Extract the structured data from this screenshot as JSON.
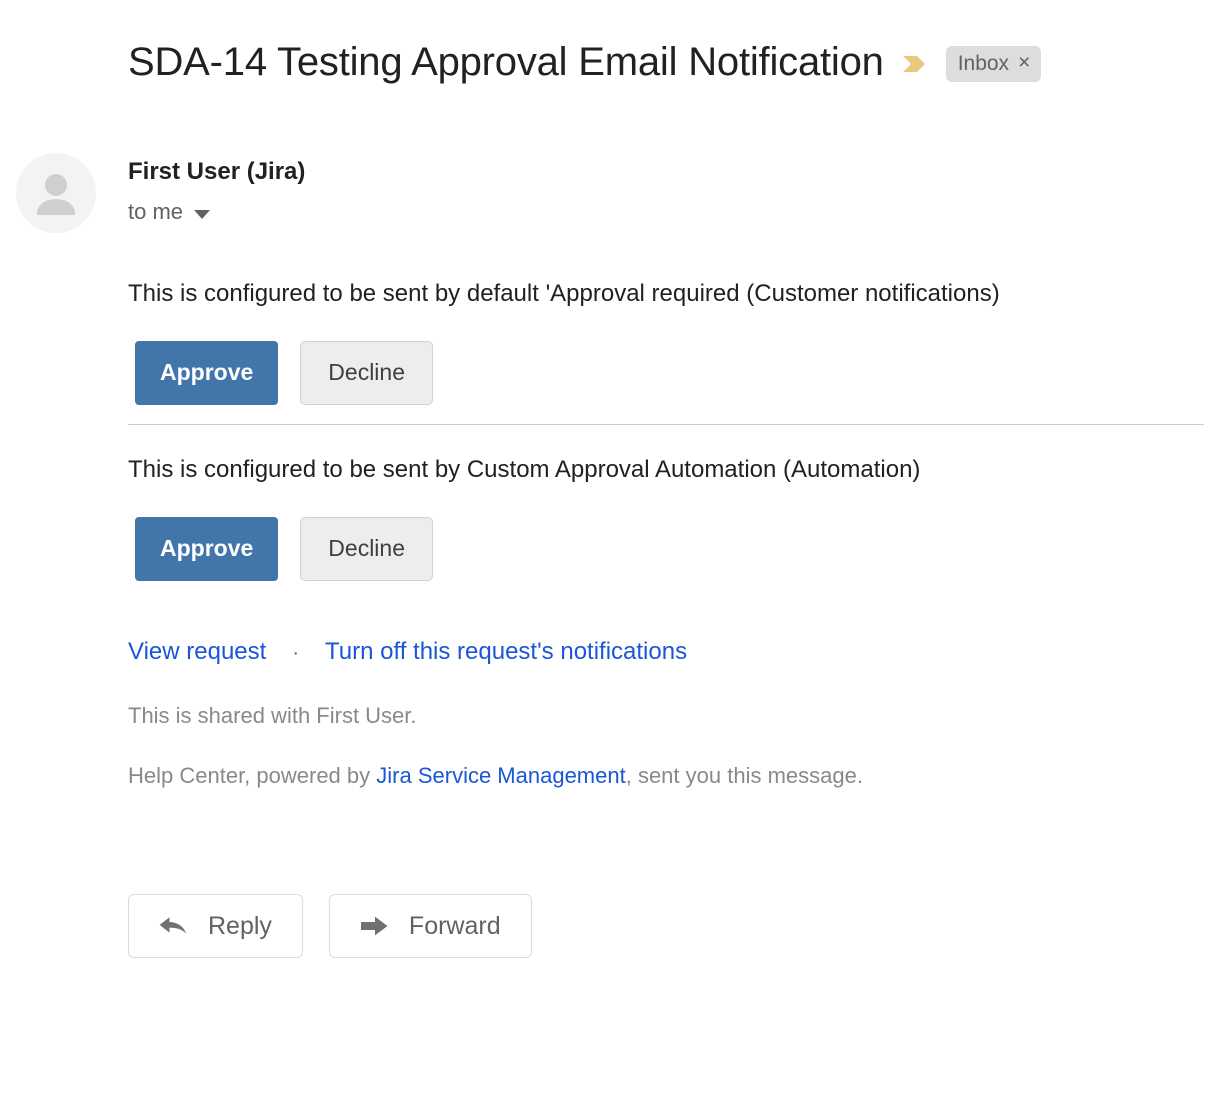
{
  "header": {
    "subject": "SDA-14 Testing Approval Email Notification",
    "important_marker_icon": "important-chevron-icon",
    "important_marker_color": "#e9c97e",
    "label_chip": {
      "text": "Inbox",
      "close_glyph": "×"
    }
  },
  "sender": {
    "avatar_icon": "person-avatar-icon",
    "name": "First User (Jira)",
    "recipient": "to me",
    "caret_icon": "chevron-down-icon"
  },
  "sections": [
    {
      "message": "This is configured to be sent by default 'Approval required (Customer notifications)",
      "approve_label": "Approve",
      "decline_label": "Decline"
    },
    {
      "message": "This is configured to be sent by Custom Approval Automation (Automation)",
      "approve_label": "Approve",
      "decline_label": "Decline"
    }
  ],
  "links": {
    "view_request": "View request",
    "separator": "·",
    "turn_off": "Turn off this request's notifications"
  },
  "footer": {
    "shared_note": "This is shared with First User.",
    "powered_prefix": "Help Center, powered by ",
    "powered_link": "Jira Service Management",
    "powered_suffix": ", sent you this message."
  },
  "actions": {
    "reply_label": "Reply",
    "reply_icon": "reply-arrow-icon",
    "forward_label": "Forward",
    "forward_icon": "forward-arrow-icon"
  },
  "colors": {
    "approve_button": "#4276ab",
    "decline_button": "#ededed",
    "link_blue": "#1a56d6",
    "muted_text": "#868a8e"
  }
}
